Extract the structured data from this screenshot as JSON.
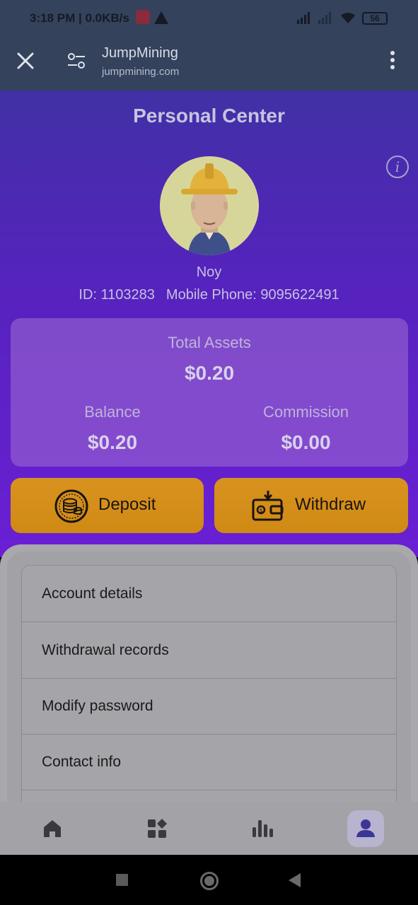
{
  "status_bar": {
    "time_network": "3:18 PM | 0.0KB/s",
    "battery": "56"
  },
  "browser": {
    "site_name": "JumpMining",
    "site_url": "jumpmining.com"
  },
  "page": {
    "title": "Personal Center"
  },
  "profile": {
    "name": "Noy",
    "id_text": "ID: 1103283",
    "phone_text": "Mobile Phone: 9095622491"
  },
  "assets": {
    "total_label": "Total Assets",
    "total_value": "$0.20",
    "balance_label": "Balance",
    "balance_value": "$0.20",
    "commission_label": "Commission",
    "commission_value": "$0.00"
  },
  "actions": {
    "deposit_label": "Deposit",
    "withdraw_label": "Withdraw"
  },
  "menu": {
    "items": [
      {
        "label": "Account details"
      },
      {
        "label": "Withdrawal records"
      },
      {
        "label": "Modify password"
      },
      {
        "label": "Contact info"
      }
    ]
  },
  "bottom_nav": {
    "items": [
      {
        "icon": "home-icon"
      },
      {
        "icon": "apps-icon"
      },
      {
        "icon": "stats-icon"
      },
      {
        "icon": "profile-icon",
        "active": true
      }
    ]
  },
  "colors": {
    "hero_top": "#4131a5",
    "hero_bottom": "#6a1fd4",
    "button_orange": "#d9921f",
    "active_nav": "#3b3596"
  }
}
